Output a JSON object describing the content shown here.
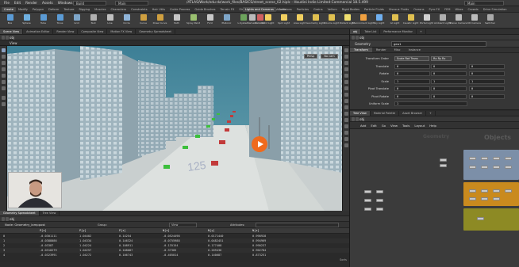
{
  "titlebar": {
    "menus": [
      "File",
      "Edit",
      "Render",
      "Assets",
      "Windows",
      "Help"
    ],
    "desktop": "Build",
    "desktop2": "Main",
    "title": "/ATLAS/Work/edu-dz/work_files/BASICS/street_scene_02.hiplc - Houdini Indie Limited-Commercial 18.5.499",
    "workspace": "Main"
  },
  "shelf_tabs_left": [
    "Create",
    "Modify",
    "Polygon",
    "Deform",
    "Texture",
    "Rigging",
    "Muscles",
    "Characters",
    "Constraints",
    "Hair Utils",
    "Guide Process",
    "Guide Brushes",
    "Terrain FX",
    "Simple FX",
    "Cloud FX",
    "Volume"
  ],
  "shelf_tabs_right": [
    "Lights and Cameras",
    "Collisions",
    "Particles",
    "Grains",
    "Vellum",
    "Rigid Bodies",
    "Particle Fluids",
    "Viscous Fluids",
    "Oceans",
    "Pyro FX",
    "FEM",
    "Wires",
    "Crowds",
    "Drive Simulation"
  ],
  "shelf_tools_left": [
    {
      "label": "Box",
      "color": "#5b9bd5"
    },
    {
      "label": "Sphere",
      "color": "#6fb0e0"
    },
    {
      "label": "Tube",
      "color": "#5b9bd5"
    },
    {
      "label": "Torus",
      "color": "#5b9bd5"
    },
    {
      "label": "Grid",
      "color": "#7ea6c9"
    },
    {
      "label": "Null",
      "color": "#b0b0b0"
    },
    {
      "label": "Line",
      "color": "#c0c0c0"
    },
    {
      "label": "Circle",
      "color": "#8fb4d8"
    },
    {
      "label": "Curve",
      "color": "#d0a040"
    },
    {
      "label": "Draw Curve",
      "color": "#d0a040"
    },
    {
      "label": "Path",
      "color": "#c6c6c6"
    },
    {
      "label": "Spray Paint",
      "color": "#9ac070"
    },
    {
      "label": "Font",
      "color": "#c9c9c9"
    },
    {
      "label": "Platonic",
      "color": "#7ea6c9"
    },
    {
      "label": "L-System",
      "color": "#6ca35c"
    },
    {
      "label": "Metaball",
      "color": "#d06060"
    }
  ],
  "shelf_tools_right": [
    {
      "label": "Camera",
      "color": "#bbbbbb"
    },
    {
      "label": "Point Light",
      "color": "#f2d060"
    },
    {
      "label": "Spot Light",
      "color": "#f2d060"
    },
    {
      "label": "Area Light",
      "color": "#f2d060"
    },
    {
      "label": "Geometry Light",
      "color": "#e0c050"
    },
    {
      "label": "Volume Light",
      "color": "#e0c050"
    },
    {
      "label": "Distant Light",
      "color": "#f0e070"
    },
    {
      "label": "Environment Light",
      "color": "#f0a040"
    },
    {
      "label": "Sky Light",
      "color": "#70b0f0"
    },
    {
      "label": "GI Light",
      "color": "#e0c050"
    },
    {
      "label": "Caustic Light",
      "color": "#e0c050"
    },
    {
      "label": "Portal Light",
      "color": "#d0d0d0"
    },
    {
      "label": "Ambient Light",
      "color": "#b0b0b0"
    },
    {
      "label": "Stereo Camera",
      "color": "#bbbbbb"
    },
    {
      "label": "VR Camera",
      "color": "#bbbbbb"
    },
    {
      "label": "Switcher",
      "color": "#aaaaaa"
    }
  ],
  "left_pane_tabs": [
    "Scene View",
    "Animation Editor",
    "Render View",
    "Composite View",
    "Motion FX View",
    "Geometry Spreadsheet"
  ],
  "left_path": "obj",
  "viewport": {
    "label": "View",
    "persp": "Persp",
    "camera": "No cam",
    "street_marking": "125"
  },
  "sheet": {
    "tabs": [
      "Geometry Spreadsheet",
      "Tree View"
    ],
    "path": "obj",
    "node": "Node: Geometry_lamppost",
    "group_label": "Group:",
    "view_mode": "View",
    "attr_label": "Attributes:",
    "headers": [
      "",
      "P[x]",
      "P[y]",
      "P[z]",
      "N[x]",
      "N[y]",
      "N[z]"
    ],
    "rows": [
      [
        "0",
        "-0.0301111",
        "1.04402",
        "0.14254",
        "-0.0524498",
        "0.0171440",
        "0.998928"
      ],
      [
        "1",
        "-0.0388086",
        "1.04334",
        "0.146324",
        "-0.0755988",
        "0.0482451",
        "0.994969"
      ],
      [
        "2",
        "-0.03387",
        "1.04224",
        "0.108911",
        "-0.135154",
        "0.177408",
        "0.990237"
      ],
      [
        "3",
        "-0.0310279",
        "1.04257",
        "0.108087",
        "-0.37305",
        "0.269436",
        "0.902784"
      ],
      [
        "4",
        "-0.0323991",
        "1.04272",
        "0.106743",
        "-0.405014",
        "0.140687",
        "0.873251"
      ]
    ],
    "footer": "Sorts"
  },
  "right_pane_tabs": [
    "obj",
    "Take List",
    "Performance Monitor",
    "+"
  ],
  "right_path": "obj",
  "parm": {
    "type": "Geometry",
    "name": "geo1",
    "tabs": [
      "Transform",
      "Render",
      "Misc",
      "Instance"
    ],
    "active_tab": "Transform",
    "rows": [
      {
        "label": "Transform Order",
        "menu1": "Scale Rot Trans",
        "menu2": "Rx Ry Rz"
      },
      {
        "label": "Translate",
        "values": [
          "0",
          "0",
          "0"
        ]
      },
      {
        "label": "Rotate",
        "values": [
          "0",
          "0",
          "0"
        ]
      },
      {
        "label": "Scale",
        "values": [
          "1",
          "1",
          "1"
        ]
      },
      {
        "label": "Pivot Translate",
        "values": [
          "0",
          "0",
          "0"
        ]
      },
      {
        "label": "Pivot Rotate",
        "values": [
          "0",
          "0",
          "0"
        ]
      },
      {
        "label": "Uniform Scale",
        "values": [
          "1"
        ]
      }
    ]
  },
  "network": {
    "tabs": [
      "Tree View",
      "Material Palette",
      "Asset Browser",
      "+"
    ],
    "path": "obj",
    "menu": [
      "Add",
      "Edit",
      "Go",
      "View",
      "Tools",
      "Layout",
      "Help"
    ],
    "context_label": "Objects",
    "context_label2": "Geometry"
  }
}
